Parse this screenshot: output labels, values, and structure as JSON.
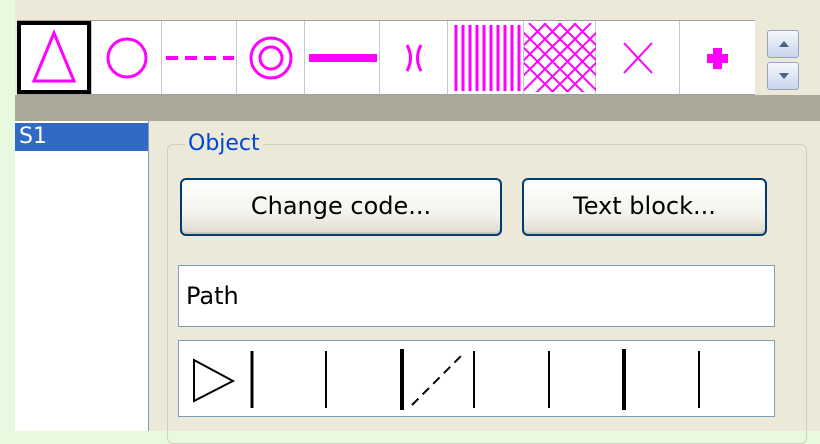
{
  "palette": {
    "accent_color": "#ff00ff",
    "symbols": [
      {
        "icon": "triangle-icon",
        "selected": true
      },
      {
        "icon": "circle-icon",
        "selected": false
      },
      {
        "icon": "dashed-line-icon",
        "selected": false
      },
      {
        "icon": "double-circle-icon",
        "selected": false
      },
      {
        "icon": "thick-line-icon",
        "selected": false
      },
      {
        "icon": "passage-icon",
        "selected": false
      },
      {
        "icon": "vertical-hatch-icon",
        "selected": false
      },
      {
        "icon": "cross-hatch-icon",
        "selected": false
      },
      {
        "icon": "x-mark-icon",
        "selected": false
      },
      {
        "icon": "plus-icon",
        "selected": false
      }
    ]
  },
  "list": {
    "items": [
      {
        "label": "S1",
        "selected": true
      }
    ]
  },
  "object_group": {
    "title": "Object",
    "change_code_label": "Change code...",
    "text_block_label": "Text block...",
    "name_value": "Path"
  },
  "path_segments": [
    "start-triangle-icon",
    "solid-tick",
    "solid-tick",
    "dashed-tick",
    "solid-tick",
    "thick-tick",
    "solid-tick"
  ]
}
